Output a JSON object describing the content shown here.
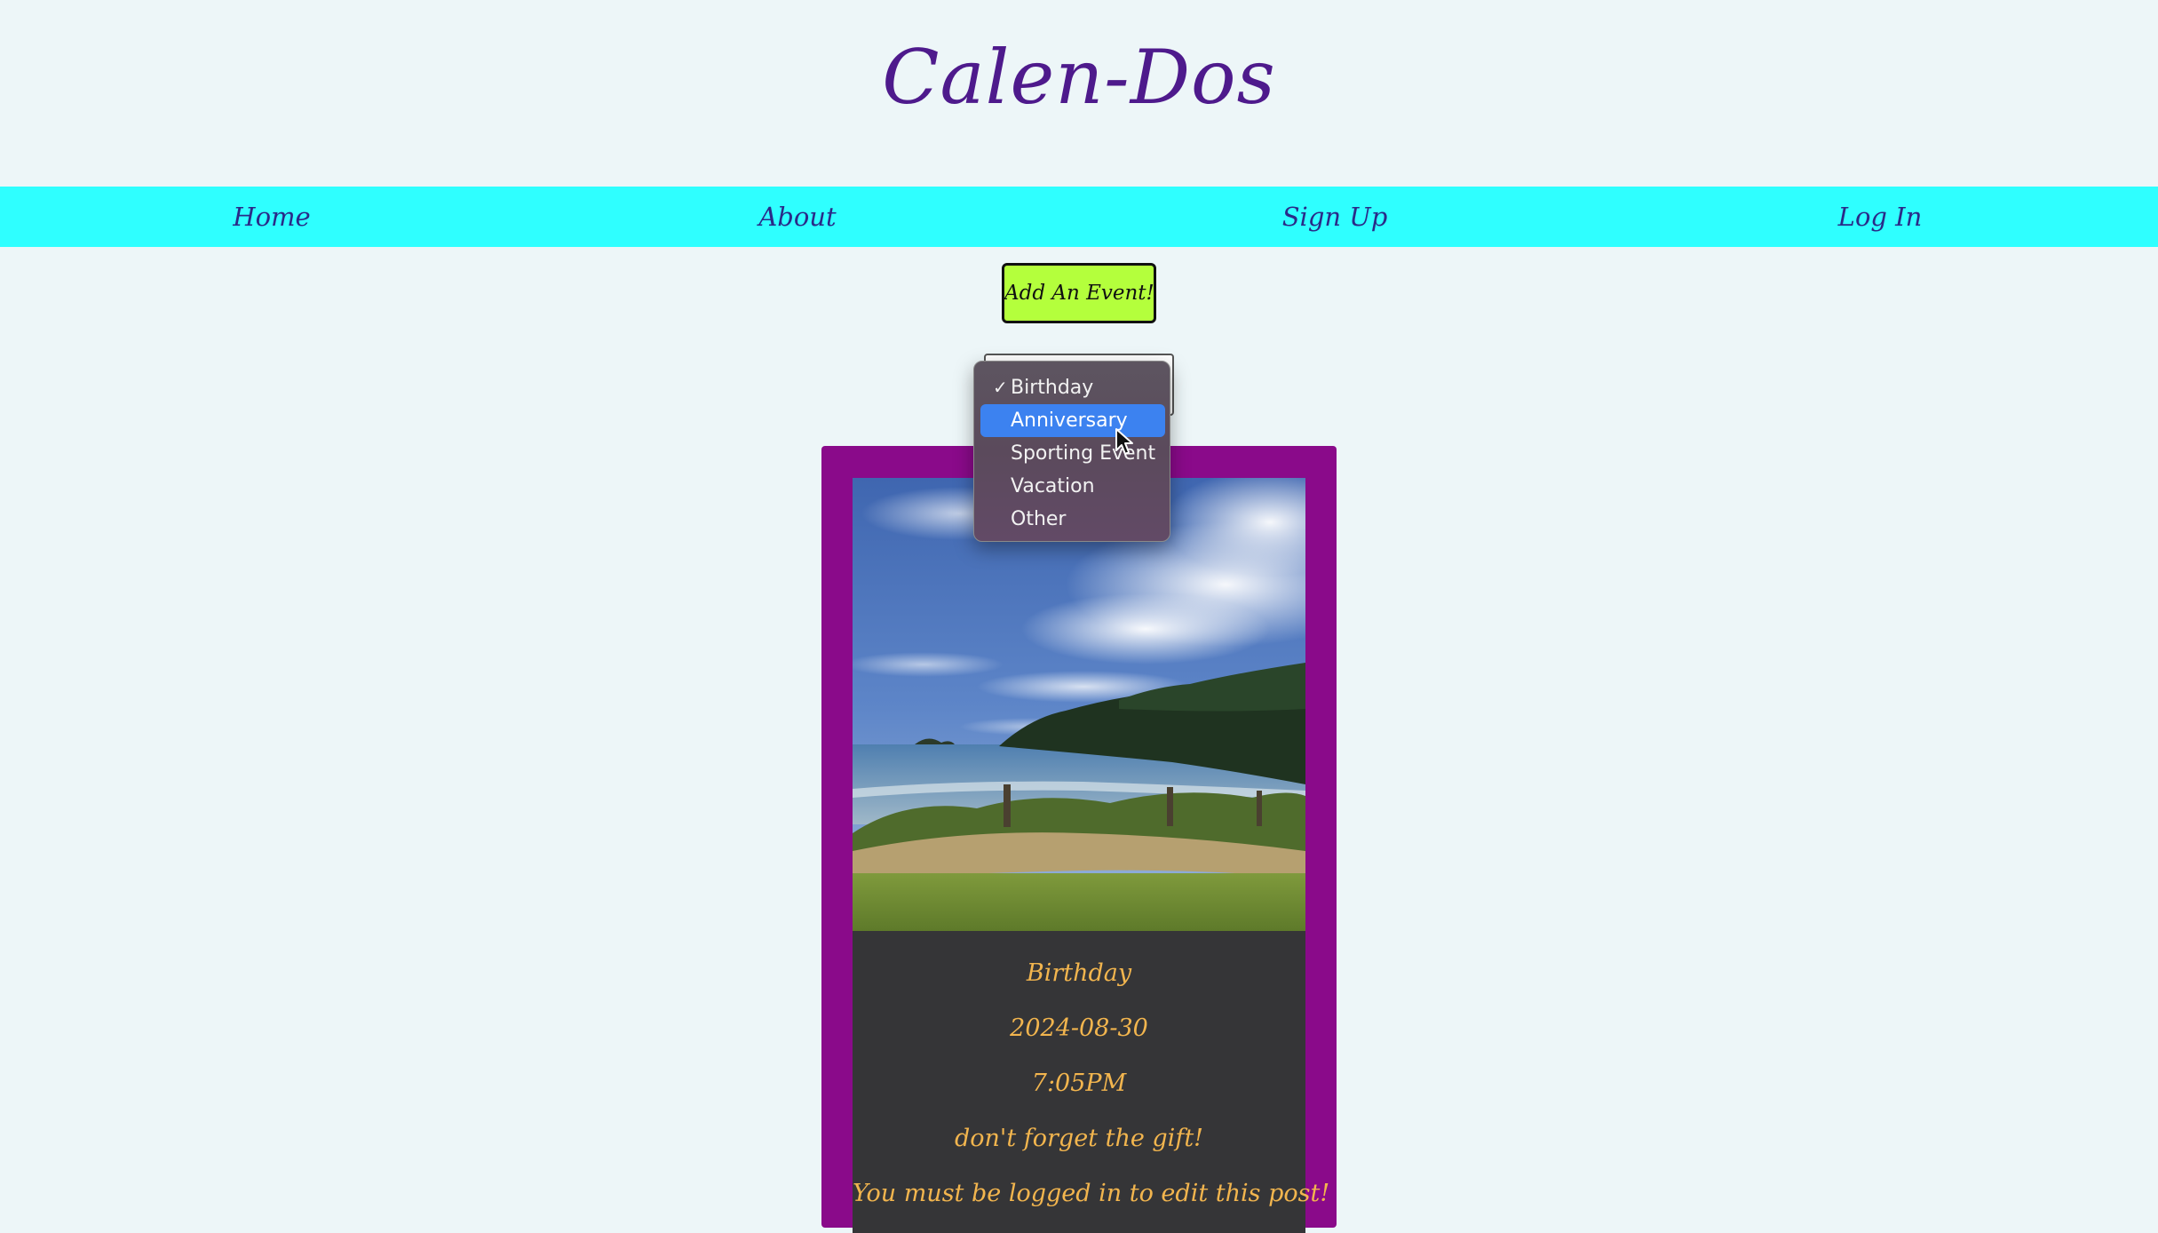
{
  "header": {
    "title": "Calen-Dos"
  },
  "nav": {
    "items": [
      {
        "label": "Home"
      },
      {
        "label": "About"
      },
      {
        "label": "Sign Up"
      },
      {
        "label": "Log In"
      }
    ]
  },
  "actions": {
    "add_event_label": "Add An Event!"
  },
  "category_select": {
    "selected": "Birthday",
    "highlighted": "Anniversary",
    "options": [
      {
        "label": "Birthday"
      },
      {
        "label": "Anniversary"
      },
      {
        "label": "Sporting Event"
      },
      {
        "label": "Vacation"
      },
      {
        "label": "Other"
      }
    ]
  },
  "event_card": {
    "image_icon": "beach-landscape-photo",
    "title": "Birthday",
    "date": "2024-08-30",
    "time": "7:05PM",
    "note": "don't forget the gift!",
    "edit_warning": "You must be logged in to edit this post!"
  },
  "colors": {
    "page_background": "#edf6f8",
    "title_color": "#4e1a8c",
    "nav_background": "#2fffff",
    "button_background": "#b4ff3c",
    "card_border": "#8a0a8a",
    "card_details_background": "#353537",
    "card_text": "#f2b54e",
    "dropdown_highlight": "#3c82f0"
  }
}
